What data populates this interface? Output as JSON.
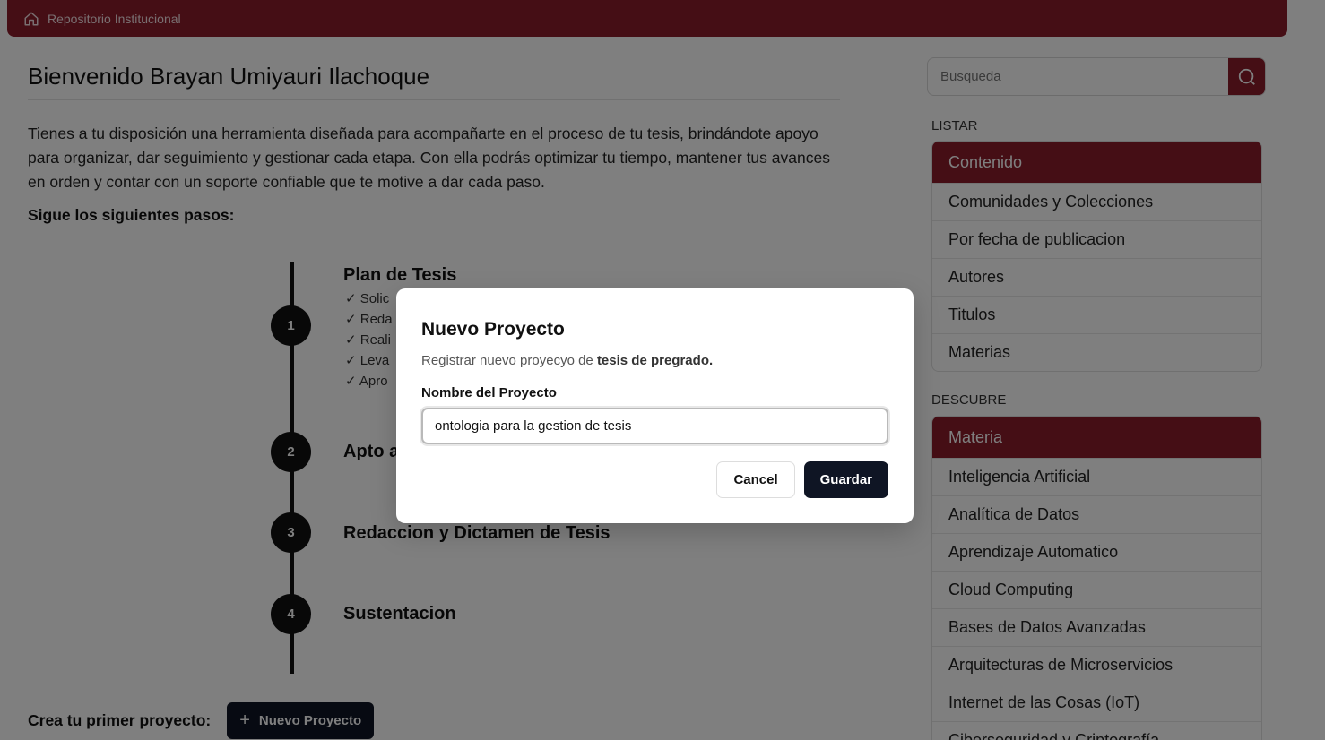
{
  "topbar": {
    "home_icon": "home-icon",
    "title": "Repositorio Institucional"
  },
  "main": {
    "title": "Bienvenido Brayan Umiyauri Ilachoque",
    "intro": "Tienes a tu disposición una herramienta diseñada para acompañarte en el proceso de tu tesis, brindándote apoyo para organizar, dar seguimiento y gestionar cada etapa. Con ella podrás optimizar tu tiempo, mantener tus avances en orden y contar con un soporte confiable que te motive a dar cada paso.",
    "steps_label": "Sigue los siguientes pasos:",
    "steps": [
      {
        "number": "1",
        "title": "Plan de Tesis",
        "items": [
          "Solic",
          "Reda",
          "Reali",
          "Leva",
          "Apro"
        ]
      },
      {
        "number": "2",
        "title": "Apto a"
      },
      {
        "number": "3",
        "title": "Redaccion y Dictamen de Tesis"
      },
      {
        "number": "4",
        "title": "Sustentacion"
      }
    ],
    "create_label": "Crea tu primer proyecto:",
    "new_project_button": "Nuevo Proyecto"
  },
  "sidebar": {
    "search_placeholder": "Busqueda",
    "search_icon": "search-icon",
    "listar_label": "LISTAR",
    "listar_items": [
      "Contenido",
      "Comunidades y Colecciones",
      "Por fecha de publicacion",
      "Autores",
      "Titulos",
      "Materias"
    ],
    "descubre_label": "DESCUBRE",
    "descubre_items": [
      "Materia",
      "Inteligencia Artificial",
      "Analítica de Datos",
      "Aprendizaje Automatico",
      "Cloud Computing",
      "Bases de Datos Avanzadas",
      "Arquitecturas de Microservicios",
      "Internet de las Cosas (IoT)",
      "Ciberseguridad y Criptografía"
    ]
  },
  "dialog": {
    "title": "Nuevo Proyecto",
    "desc_prefix": "Registrar nuevo proyecyo de ",
    "desc_bold": "tesis de pregrado.",
    "field_label": "Nombre del Proyecto",
    "field_value": "ontologia para la gestion de tesis",
    "cancel": "Cancel",
    "save": "Guardar"
  },
  "colors": {
    "brand": "#8a1c2b",
    "dark_button": "#0f1524"
  }
}
